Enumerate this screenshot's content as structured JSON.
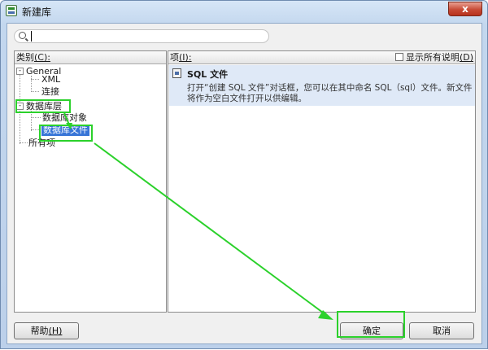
{
  "window": {
    "title": "新建库",
    "close_glyph": "x"
  },
  "search": {
    "value": "",
    "placeholder": ""
  },
  "categories": {
    "header_label": "类别",
    "header_key": "(C):",
    "tree": [
      {
        "label": "General",
        "expander": "-"
      },
      {
        "label": "XML"
      },
      {
        "label": "连接"
      },
      {
        "label": "数据库层",
        "expander": "-"
      },
      {
        "label": "数据库对象"
      },
      {
        "label": "数据库文件"
      },
      {
        "label": "所有项"
      }
    ]
  },
  "items": {
    "header_label": "项",
    "header_key": "(I):",
    "show_all_label": "显示所有说明",
    "show_all_key": "(D)",
    "show_all_checked": false,
    "list": [
      {
        "title": "SQL 文件",
        "description": "打开“创建 SQL 文件”对话框，您可以在其中命名 SQL（sql）文件。新文件将作为空白文件打开以供编辑。"
      }
    ]
  },
  "buttons": {
    "help": "帮助",
    "help_key": "(H)",
    "ok": "确定",
    "cancel": "取消"
  },
  "annotation": {
    "color": "#2bd12b"
  }
}
